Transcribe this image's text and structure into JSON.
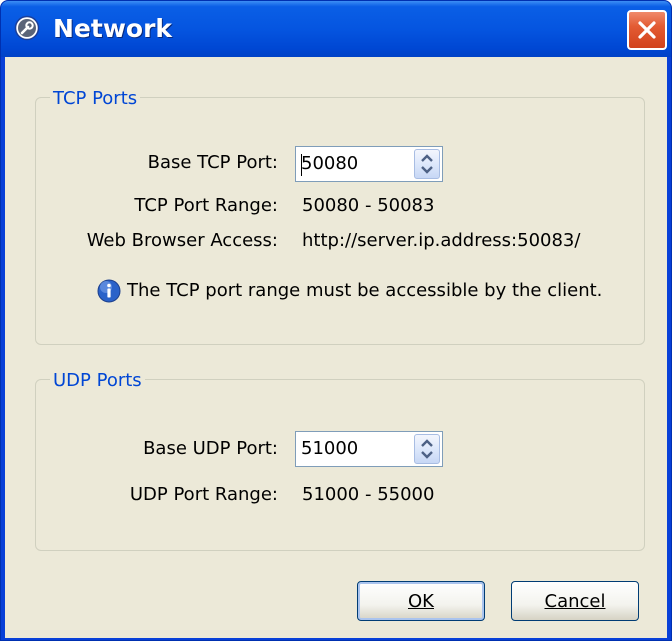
{
  "window": {
    "title": "Network"
  },
  "tcp": {
    "legend": "TCP Ports",
    "base_label": "Base TCP Port:",
    "base_value": "50080",
    "range_label": "TCP Port Range:",
    "range_value": "50080 - 50083",
    "web_label": "Web Browser Access:",
    "web_value": "http://server.ip.address:50083/",
    "note": "The TCP port range must be accessible by the client."
  },
  "udp": {
    "legend": "UDP Ports",
    "base_label": "Base UDP Port:",
    "base_value": "51000",
    "range_label": "UDP Port Range:",
    "range_value": "51000 - 55000"
  },
  "buttons": {
    "ok_label": "OK",
    "cancel_label": "Cancel"
  },
  "icons": {
    "title": "wrench-icon",
    "close": "close-icon",
    "info": "info-icon",
    "spin": "spinner-arrows-icon"
  },
  "colors": {
    "titlebar": "#0555e0",
    "face": "#ece9d8",
    "group_legend": "#0046d5",
    "close_button": "#d2421b"
  }
}
